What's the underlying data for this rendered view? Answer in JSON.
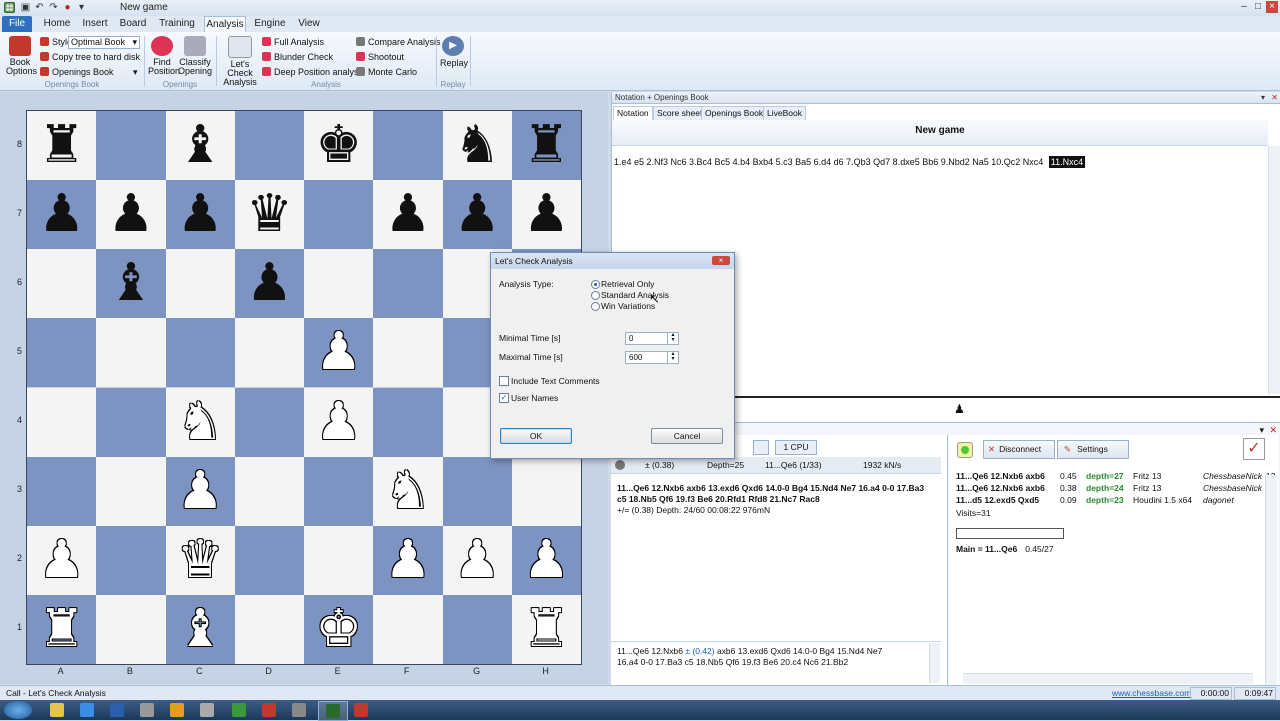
{
  "window": {
    "title": "New game"
  },
  "menu": {
    "tabs": [
      "File",
      "Home",
      "Insert",
      "Board",
      "Training",
      "Analysis",
      "Engine",
      "View"
    ],
    "active": "Analysis"
  },
  "ribbon": {
    "book_options": "Book Options",
    "style_label": "Style",
    "style_value": "Optimal Book",
    "copy_tree": "Copy tree to hard disk",
    "openings_book": "Openings Book",
    "group_openings_book": "Openings Book",
    "find_position": "Find Position",
    "classify_opening": "Classify Opening",
    "group_openings": "Openings",
    "lets_check": "Let's Check Analysis",
    "full_analysis": "Full Analysis",
    "blunder_check": "Blunder Check",
    "deep_position": "Deep Position analysis",
    "compare_analysis": "Compare Analysis",
    "shootout": "Shootout",
    "monte_carlo": "Monte Carlo",
    "group_analysis": "Analysis",
    "replay": "Replay",
    "group_replay": "Replay"
  },
  "board": {
    "files": [
      "A",
      "B",
      "C",
      "D",
      "E",
      "F",
      "G",
      "H"
    ],
    "ranks": [
      "8",
      "7",
      "6",
      "5",
      "4",
      "3",
      "2",
      "1"
    ],
    "pieces": [
      [
        "♜",
        "",
        "♝",
        "",
        "♚",
        "",
        "♞",
        "♜"
      ],
      [
        "♟",
        "♟",
        "♟",
        "♛",
        "",
        "♟",
        "♟",
        "♟"
      ],
      [
        "",
        "♝",
        "",
        "♟",
        "",
        "",
        "",
        ""
      ],
      [
        "",
        "",
        "",
        "",
        "♙",
        "",
        "",
        ""
      ],
      [
        "",
        "",
        "♘",
        "",
        "♙",
        "",
        "",
        ""
      ],
      [
        "",
        "",
        "♙",
        "",
        "",
        "♘",
        "",
        ""
      ],
      [
        "♙",
        "",
        "♕",
        "",
        "",
        "♙",
        "♙",
        "♙"
      ],
      [
        "♖",
        "",
        "♗",
        "",
        "♔",
        "",
        "",
        "♖"
      ]
    ]
  },
  "notation_panel": {
    "header": "Notation + Openings Book",
    "tabs": [
      "Notation",
      "Score sheet",
      "Openings Book",
      "LiveBook"
    ],
    "game_title": "New game",
    "moves": "1.e4  e5  2.Nf3  Nc6  3.Bc4  Bc5  4.b4  Bxb4  5.c3  Ba5  6.d4  d6  7.Qb3  Qd7  8.dxe5  Bb6  9.Nbd2  Na5  10.Qc2  Nxc4",
    "current_move": "11.Nxc4"
  },
  "engine_panel": {
    "cpu": "1 CPU",
    "eval": "± (0.38)",
    "depth": "Depth=25",
    "move": "11...Qe6 (1/33)",
    "speed": "1932 kN/s",
    "line_bold": "11...Qe6 12.Nxb6 axb6 13.exd6 Qxd6 14.0-0 Bg4 15.Nd4 Ne7 16.a4 0-0 17.Ba3",
    "line_bold2": "c5 18.Nb5 Qf6 19.f3 Be6 20.Rfd1 Rfd8 21.Nc7 Rac8",
    "line_meta": "+/=  (0.38)   Depth: 24/60   00:08:22  976mN",
    "bottom_line1_a": "11...Qe6  12.Nxb6  ",
    "bottom_eval": "± (0.42)",
    "bottom_line1_b": "  axb6  13.exd6  Qxd6  14.0-0  Bg4  15.Nd4  Ne7",
    "bottom_line2": "16.a4  0-0  17.Ba3  c5  18.Nb5  Qf6  19.f3  Be6  20.c4  Nc6  21.Bb2"
  },
  "cloud_panel": {
    "disconnect": "Disconnect",
    "settings": "Settings",
    "rows": [
      {
        "line": "11...Qe6 12.Nxb6 axb6",
        "eval": "0.45",
        "depth": "depth=27",
        "engine": "Fritz 13",
        "user": "ChessbaseNick",
        "n": "12."
      },
      {
        "line": "11...Qe6 12.Nxb6 axb6",
        "eval": "0.38",
        "depth": "depth=24",
        "engine": "Fritz 13",
        "user": "ChessbaseNick",
        "n": "12."
      },
      {
        "line": "11...d5 12.exd5 Qxd5",
        "eval": "0.09",
        "depth": "depth=23",
        "engine": "Houdini 1.5 x64",
        "user": "dagonet",
        "n": "11."
      }
    ],
    "visits": "Visits=31",
    "main_label": "Main = 11...Qe6",
    "main_value": "0.45/27"
  },
  "dialog": {
    "title": "Let's Check Analysis",
    "analysis_type_label": "Analysis Type:",
    "options": [
      "Retrieval Only",
      "Standard Analysis",
      "Win Variations"
    ],
    "selected": "Retrieval Only",
    "min_time_label": "Minimal Time [s]",
    "min_time_value": "0",
    "max_time_label": "Maximal Time [s]",
    "max_time_value": "600",
    "include_comments": "Include Text Comments",
    "include_comments_checked": false,
    "user_names": "User Names",
    "user_names_checked": true,
    "ok": "OK",
    "cancel": "Cancel"
  },
  "status": {
    "left": "Call - Let's Check Analysis",
    "link": "www.chessbase.com",
    "clock1": "0:00:00",
    "clock2": "0:09:47"
  },
  "colors": {
    "light_square": "#f4f4f4",
    "dark_square": "#7d93c1",
    "accent": "#2d6fc2"
  }
}
